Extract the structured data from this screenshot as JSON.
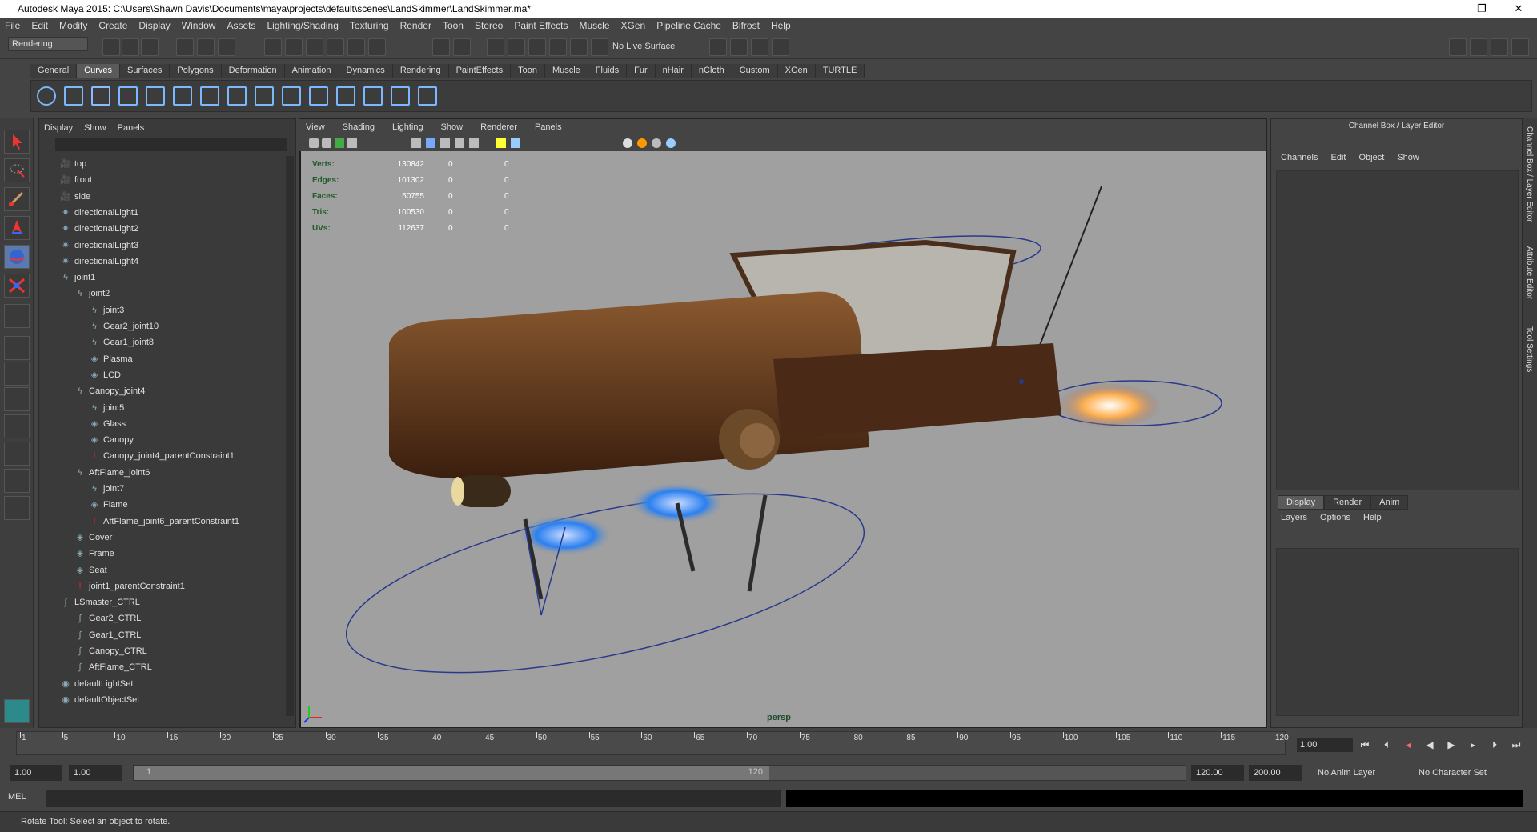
{
  "window": {
    "title": "Autodesk Maya 2015: C:\\Users\\Shawn Davis\\Documents\\maya\\projects\\default\\scenes\\LandSkimmer\\LandSkimmer.ma*"
  },
  "menu": [
    "File",
    "Edit",
    "Modify",
    "Create",
    "Display",
    "Window",
    "Assets",
    "Lighting/Shading",
    "Texturing",
    "Render",
    "Toon",
    "Stereo",
    "Paint Effects",
    "Muscle",
    "XGen",
    "Pipeline Cache",
    "Bifrost",
    "Help"
  ],
  "status": {
    "mode": "Rendering",
    "live_surface": "No Live Surface"
  },
  "shelf_tabs": [
    "General",
    "Curves",
    "Surfaces",
    "Polygons",
    "Deformation",
    "Animation",
    "Dynamics",
    "Rendering",
    "PaintEffects",
    "Toon",
    "Muscle",
    "Fluids",
    "Fur",
    "nHair",
    "nCloth",
    "Custom",
    "XGen",
    "TURTLE"
  ],
  "shelf_active": "Curves",
  "outliner": {
    "menu": [
      "Display",
      "Show",
      "Panels"
    ],
    "items": [
      {
        "label": "top",
        "icon": "camera-icon",
        "depth": 0
      },
      {
        "label": "front",
        "icon": "camera-icon",
        "depth": 0
      },
      {
        "label": "side",
        "icon": "camera-icon",
        "depth": 0
      },
      {
        "label": "directionalLight1",
        "icon": "light-icon",
        "depth": 0
      },
      {
        "label": "directionalLight2",
        "icon": "light-icon",
        "depth": 0
      },
      {
        "label": "directionalLight3",
        "icon": "light-icon",
        "depth": 0
      },
      {
        "label": "directionalLight4",
        "icon": "light-icon",
        "depth": 0
      },
      {
        "label": "joint1",
        "icon": "joint-icon",
        "depth": 0
      },
      {
        "label": "joint2",
        "icon": "joint-icon",
        "depth": 1
      },
      {
        "label": "joint3",
        "icon": "joint-icon",
        "depth": 2
      },
      {
        "label": "Gear2_joint10",
        "icon": "joint-icon",
        "depth": 2
      },
      {
        "label": "Gear1_joint8",
        "icon": "joint-icon",
        "depth": 2
      },
      {
        "label": "Plasma",
        "icon": "mesh-icon",
        "depth": 2
      },
      {
        "label": "LCD",
        "icon": "mesh-icon",
        "depth": 2
      },
      {
        "label": "Canopy_joint4",
        "icon": "joint-icon",
        "depth": 1
      },
      {
        "label": "joint5",
        "icon": "joint-icon",
        "depth": 2
      },
      {
        "label": "Glass",
        "icon": "mesh-icon",
        "depth": 2
      },
      {
        "label": "Canopy",
        "icon": "mesh-icon",
        "depth": 2
      },
      {
        "label": "Canopy_joint4_parentConstraint1",
        "icon": "constraint-icon",
        "depth": 2
      },
      {
        "label": "AftFlame_joint6",
        "icon": "joint-icon",
        "depth": 1
      },
      {
        "label": "joint7",
        "icon": "joint-icon",
        "depth": 2
      },
      {
        "label": "Flame",
        "icon": "mesh-icon",
        "depth": 2
      },
      {
        "label": "AftFlame_joint6_parentConstraint1",
        "icon": "constraint-icon",
        "depth": 2
      },
      {
        "label": "Cover",
        "icon": "mesh-icon",
        "depth": 1
      },
      {
        "label": "Frame",
        "icon": "mesh-icon",
        "depth": 1
      },
      {
        "label": "Seat",
        "icon": "mesh-icon",
        "depth": 1
      },
      {
        "label": "joint1_parentConstraint1",
        "icon": "constraint-icon",
        "depth": 1
      },
      {
        "label": "LSmaster_CTRL",
        "icon": "curve-icon",
        "depth": 0
      },
      {
        "label": "Gear2_CTRL",
        "icon": "curve-icon",
        "depth": 1
      },
      {
        "label": "Gear1_CTRL",
        "icon": "curve-icon",
        "depth": 1
      },
      {
        "label": "Canopy_CTRL",
        "icon": "curve-icon",
        "depth": 1
      },
      {
        "label": "AftFlame_CTRL",
        "icon": "curve-icon",
        "depth": 1
      },
      {
        "label": "defaultLightSet",
        "icon": "set-icon",
        "depth": 0
      },
      {
        "label": "defaultObjectSet",
        "icon": "set-icon",
        "depth": 0
      }
    ]
  },
  "viewport": {
    "menu": [
      "View",
      "Shading",
      "Lighting",
      "Show",
      "Renderer",
      "Panels"
    ],
    "hud": [
      {
        "label": "Verts:",
        "v": "130842",
        "a": "0",
        "b": "0"
      },
      {
        "label": "Edges:",
        "v": "101302",
        "a": "0",
        "b": "0"
      },
      {
        "label": "Faces:",
        "v": "50755",
        "a": "0",
        "b": "0"
      },
      {
        "label": "Tris:",
        "v": "100530",
        "a": "0",
        "b": "0"
      },
      {
        "label": "UVs:",
        "v": "112637",
        "a": "0",
        "b": "0"
      }
    ],
    "camera": "persp"
  },
  "channel_box": {
    "title": "Channel Box / Layer Editor",
    "menu": [
      "Channels",
      "Edit",
      "Object",
      "Show"
    ],
    "layer_tabs": [
      "Display",
      "Render",
      "Anim"
    ],
    "layer_menu": [
      "Layers",
      "Options",
      "Help"
    ]
  },
  "side_tabs": [
    "Channel Box / Layer Editor",
    "Attribute Editor",
    "Tool Settings"
  ],
  "timeline": {
    "ticks": [
      "1",
      "5",
      "10",
      "15",
      "20",
      "25",
      "30",
      "35",
      "40",
      "45",
      "50",
      "55",
      "60",
      "65",
      "70",
      "75",
      "80",
      "85",
      "90",
      "95",
      "100",
      "105",
      "110",
      "115",
      "120"
    ],
    "current": "1.00"
  },
  "range": {
    "start": "1.00",
    "start2": "1.00",
    "inner_start": "1",
    "inner_end": "120",
    "end": "120.00",
    "end2": "200.00",
    "anim_layer": "No Anim Layer",
    "char_set": "No Character Set"
  },
  "cmd": {
    "label": "MEL"
  },
  "help": "Rotate Tool: Select an object to rotate."
}
